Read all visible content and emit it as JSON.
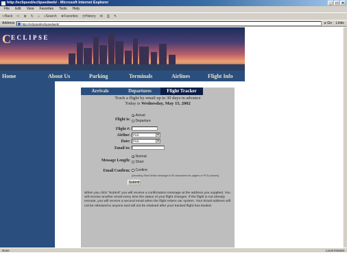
{
  "browser": {
    "title": "http://eclipsed/eclipsedweb/ - Microsoft Internet Explorer",
    "menu": [
      "File",
      "Edit",
      "View",
      "Favorites",
      "Tools",
      "Help"
    ],
    "toolbar": [
      "Back",
      "Search",
      "Favorites",
      "History"
    ],
    "address_label": "Address",
    "url": "http://eclipsed/eclipsedweb/",
    "go_label": "Go",
    "links_label": "Links",
    "status_left": "Done",
    "status_zone": "Local intranet"
  },
  "site": {
    "logo_letter": "C",
    "logo_rest": "ECLIPSE",
    "nav": [
      "Home",
      "About Us",
      "Parking",
      "Terminals",
      "Airlines",
      "Flight Info"
    ]
  },
  "tracker": {
    "tabs": [
      "Arrivals",
      "Departures",
      "Flight Tracker"
    ],
    "intro": "Track a flight by email up to 30 days in advance",
    "today_prefix": "Today is ",
    "today_date": "Wednesday, May 15, 2002",
    "fields": {
      "flight_is_label": "Flight is:",
      "flight_is_options": [
        "Arrival",
        "Departure"
      ],
      "flight_num_label": "Flight #:",
      "airline_label": "Airline:",
      "airline_value": "Pick",
      "date_label": "Date:",
      "date_value": "Pick",
      "email_label": "Email to:",
      "message_length_label": "Message Length:",
      "message_length_options": [
        "Normal",
        "Short"
      ],
      "email_confirm_label": "Email Confirm:",
      "email_confirm_option": "Confirm",
      "short_note": "(choosing Short limits message to 50 characters for pagers or PCS phones)"
    },
    "submit_label": "Submit",
    "explanation": "When you click \"Submit\" you will receive a confirmation message at the address you supplied. You will receive another email every time the status of your flight changes. If the flight is not already enroute, you will receive a second email when the flight enters our system. Your Email address will not be released to anyone and will not be retained after your tracked flight has landed."
  },
  "colors": {
    "nav_blue": "#2a4f7e",
    "active_tab": "#0b1e45",
    "panel_gray": "#bebebe",
    "nav_text": "#f0e6c8"
  }
}
